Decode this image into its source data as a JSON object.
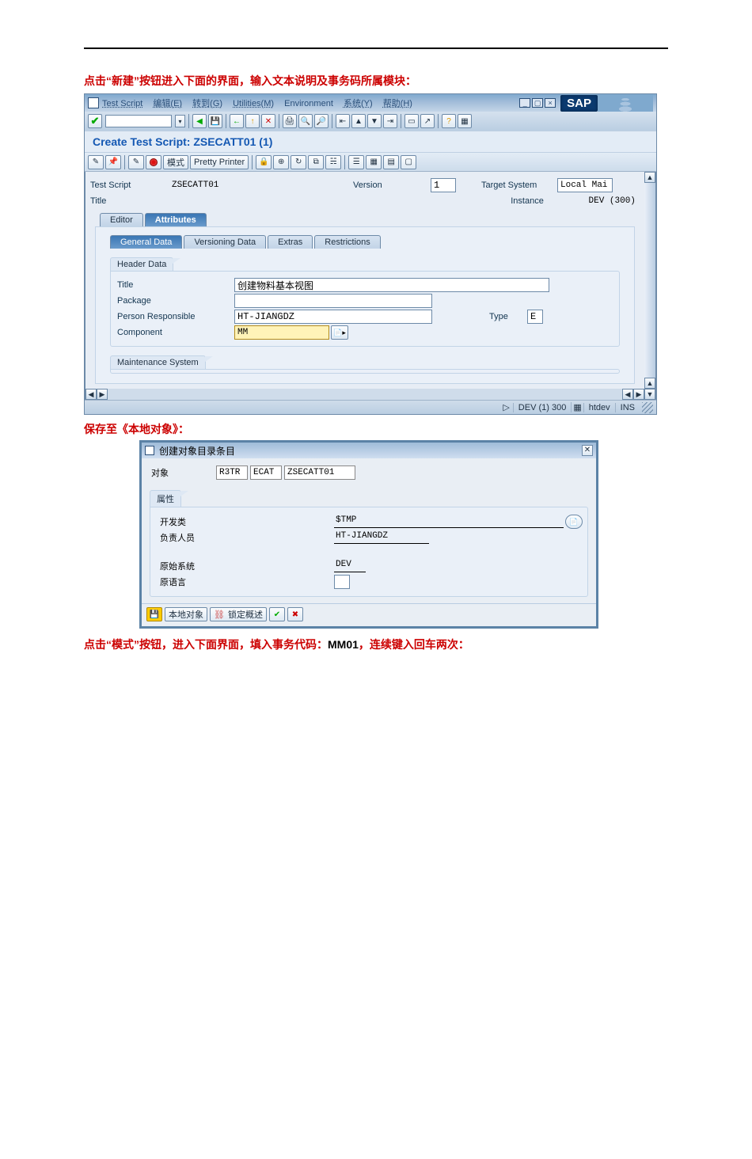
{
  "caption1": "点击“新建”按钮进入下面的界面，输入文本说明及事务码所属模块：",
  "caption2": "保存至《本地对象》：",
  "caption3_red1": "点击“模式”按钮，进入下面界面，填入事务代码：",
  "caption3_black": "MM01",
  "caption3_red2": "，连续键入回车两次：",
  "sap": {
    "menu": {
      "test_script": "Test Script",
      "edit": "编辑(E)",
      "goto": "转到(G)",
      "utilities": "Utilities(M)",
      "environment": "Environment",
      "system": "系统(Y)",
      "help": "帮助(H)"
    },
    "logo": "SAP",
    "subtitle": "Create Test Script: ZSECATT01 (1)",
    "apptb": {
      "mode": "模式",
      "pretty": "Pretty Printer"
    },
    "fields": {
      "test_script_lbl": "Test Script",
      "test_script_val": "ZSECATT01",
      "version_lbl": "Version",
      "version_val": "1",
      "target_lbl": "Target System",
      "target_val": "Local Mai",
      "title_lbl": "Title",
      "instance_lbl": "Instance",
      "instance_val": "DEV (300)"
    },
    "tabs": {
      "editor": "Editor",
      "attributes": "Attributes"
    },
    "subtabs": {
      "general": "General Data",
      "versioning": "Versioning Data",
      "extras": "Extras",
      "restrictions": "Restrictions"
    },
    "header": {
      "section": "Header Data",
      "title_lbl": "Title",
      "title_val": "创建物料基本视图",
      "package_lbl": "Package",
      "person_lbl": "Person Responsible",
      "person_val": "HT-JIANGDZ",
      "type_lbl": "Type",
      "type_val": "E",
      "component_lbl": "Component",
      "component_val": "MM"
    },
    "maint_section": "Maintenance System",
    "status": {
      "system": "DEV (1) 300",
      "host": "htdev",
      "ins": "INS"
    }
  },
  "dialog": {
    "title": "创建对象目录条目",
    "object_lbl": "对象",
    "obj1": "R3TR",
    "obj2": "ECAT",
    "obj3": "ZSECATT01",
    "attr_section": "属性",
    "devclass_lbl": "开发类",
    "devclass_val": "$TMP",
    "person_lbl": "负责人员",
    "person_val": "HT-JIANGDZ",
    "origsys_lbl": "原始系统",
    "origsys_val": "DEV",
    "origlang_lbl": "原语言",
    "btn_local": "本地对象",
    "btn_lock": "锁定概述"
  }
}
